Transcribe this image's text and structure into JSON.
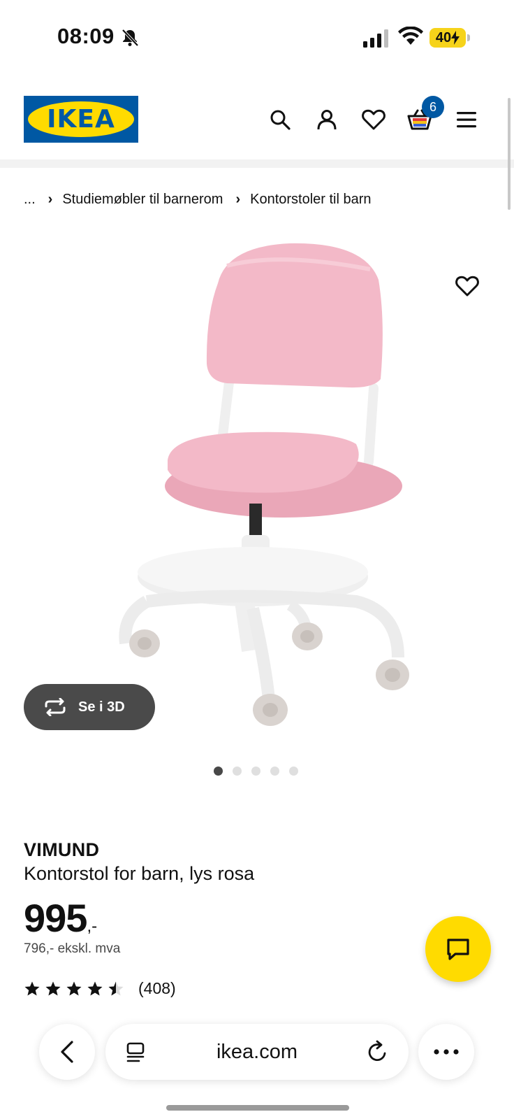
{
  "status_bar": {
    "time": "08:09",
    "battery": "40",
    "icons": [
      "bell-off-icon",
      "cellular-signal-icon",
      "wifi-icon",
      "battery-charging-icon"
    ]
  },
  "header": {
    "logo_text": "IKEA",
    "cart_count": "6",
    "icons": [
      "search-icon",
      "user-icon",
      "heart-icon",
      "cart-icon",
      "menu-icon"
    ]
  },
  "breadcrumb": {
    "ellipsis": "...",
    "items": [
      "Studiemøbler til barnerom",
      "Kontorstoler til barn"
    ]
  },
  "gallery": {
    "see_3d_label": "Se i 3D",
    "dot_count": 5,
    "active_dot": 0
  },
  "product": {
    "brand": "VIMUND",
    "description": "Kontorstol for barn, lys rosa",
    "price": "995",
    "price_suffix": ",-",
    "price_ex_vat": "796,- ekskl. mva",
    "rating_value": 4.5,
    "rating_max": 5,
    "review_count": "(408)"
  },
  "browser": {
    "url": "ikea.com"
  },
  "colors": {
    "ikea_blue": "#0058a3",
    "ikea_yellow": "#ffdb00",
    "chair_pink": "#f2b8c6",
    "button_dark": "#4a4a4a"
  }
}
